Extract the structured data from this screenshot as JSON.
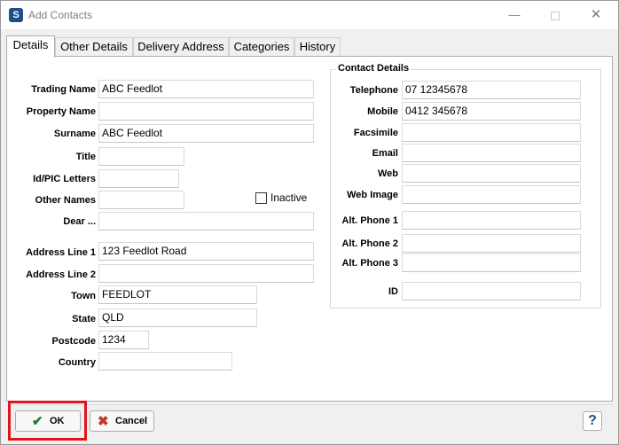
{
  "window": {
    "title": "Add Contacts",
    "minimize": "—",
    "close": "✕"
  },
  "tabs": [
    {
      "label": "Details"
    },
    {
      "label": "Other Details"
    },
    {
      "label": "Delivery Address"
    },
    {
      "label": "Categories"
    },
    {
      "label": "History"
    }
  ],
  "details": {
    "trading_name": {
      "label": "Trading Name",
      "value": "ABC Feedlot"
    },
    "property_name": {
      "label": "Property Name",
      "value": ""
    },
    "surname": {
      "label": "Surname",
      "value": "ABC Feedlot"
    },
    "title": {
      "label": "Title",
      "value": ""
    },
    "id_pic": {
      "label": "Id/PIC Letters",
      "value": ""
    },
    "other_names": {
      "label": "Other Names",
      "value": ""
    },
    "inactive": {
      "label": "Inactive",
      "checked": false
    },
    "dear": {
      "label": "Dear ...",
      "value": ""
    },
    "address1": {
      "label": "Address Line 1",
      "value": "123 Feedlot Road"
    },
    "address2": {
      "label": "Address Line 2",
      "value": ""
    },
    "town": {
      "label": "Town",
      "value": "FEEDLOT"
    },
    "state": {
      "label": "State",
      "value": "QLD"
    },
    "postcode": {
      "label": "Postcode",
      "value": "1234"
    },
    "country": {
      "label": "Country",
      "value": ""
    }
  },
  "contact": {
    "group_title": "Contact Details",
    "telephone": {
      "label": "Telephone",
      "value": "07 12345678"
    },
    "mobile": {
      "label": "Mobile",
      "value": "0412 345678"
    },
    "facsimile": {
      "label": "Facsimile",
      "value": ""
    },
    "email": {
      "label": "Email",
      "value": ""
    },
    "web": {
      "label": "Web",
      "value": ""
    },
    "web_image": {
      "label": "Web Image",
      "value": ""
    },
    "alt1": {
      "label": "Alt. Phone 1",
      "value": ""
    },
    "alt2": {
      "label": "Alt. Phone 2",
      "value": ""
    },
    "alt3": {
      "label": "Alt. Phone 3",
      "value": ""
    },
    "id": {
      "label": "ID",
      "value": ""
    }
  },
  "footer": {
    "ok_label": "OK",
    "cancel_label": "Cancel",
    "help_label": "?"
  },
  "colors": {
    "highlight": "#e0141e",
    "ok_icon": "#1e7d2c",
    "cancel_icon": "#c0392b",
    "brand": "#1d4f8c"
  }
}
